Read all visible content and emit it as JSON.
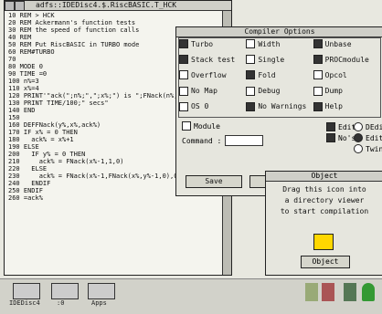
{
  "editor": {
    "title": "adfs::IDEDisc4.$.RiscBASIC.T_HCK",
    "lines": [
      "10 REM > HCK",
      "20 REM Ackermann's function tests",
      "30 REM the speed of function calls",
      "40 REM",
      "50 REM Put RiscBASIC in TURBO mode",
      "60 REM#TURBO",
      "70",
      "80 MODE 0",
      "90 TIME =0",
      "100 n%=3",
      "110 x%=4",
      "120 PRINT'\"ack(\";n%;\",\";x%;\") is \";FNack(n%,x%)",
      "130 PRINT TIME/100;\" secs\"",
      "140 END",
      "150",
      "160 DEFFNack(y%,x%,ack%)",
      "170 IF x% = 0 THEN",
      "180   ack% = x%+1",
      "190 ELSE",
      "200   IF y% = 0 THEN",
      "210     ack% = FNack(x%-1,1,0)",
      "220   ELSE",
      "230     ack% = FNack(x%-1,FNack(x%,y%-1,0),0)",
      "240   ENDIF",
      "250 ENDIF",
      "260 =ack%"
    ]
  },
  "dialog": {
    "title": "Compiler Options",
    "options": [
      {
        "label": "Turbo",
        "on": true
      },
      {
        "label": "Width",
        "on": false
      },
      {
        "label": "Unbase",
        "on": true
      },
      {
        "label": "Stack test",
        "on": true
      },
      {
        "label": "Single",
        "on": false
      },
      {
        "label": "PROCmodule",
        "on": true
      },
      {
        "label": "Overflow",
        "on": false
      },
      {
        "label": "Fold",
        "on": true
      },
      {
        "label": "Opcol",
        "on": false
      },
      {
        "label": "No Map",
        "on": false
      },
      {
        "label": "Debug",
        "on": false
      },
      {
        "label": "Dump",
        "on": false
      },
      {
        "label": "OS 0",
        "on": false
      },
      {
        "label": "No Warnings",
        "on": true
      },
      {
        "label": "Help",
        "on": true
      }
    ],
    "module_label": "Module",
    "command_label": "Command :",
    "command_value": "",
    "edit_label": "Edit",
    "edit_choice": "DEdit",
    "nos_label": "No's",
    "choices": [
      "DEdit",
      "Edit",
      "Twin"
    ],
    "save_button": "Save",
    "default_button": "Default"
  },
  "object": {
    "title": "Object",
    "text": [
      "Drag this icon into",
      "a directory viewer",
      "to start compilation"
    ],
    "button": "Object"
  },
  "iconbar": {
    "devices": [
      {
        "label": "IDEDisc4"
      },
      {
        "label": ":0"
      },
      {
        "label": "Apps"
      }
    ]
  }
}
